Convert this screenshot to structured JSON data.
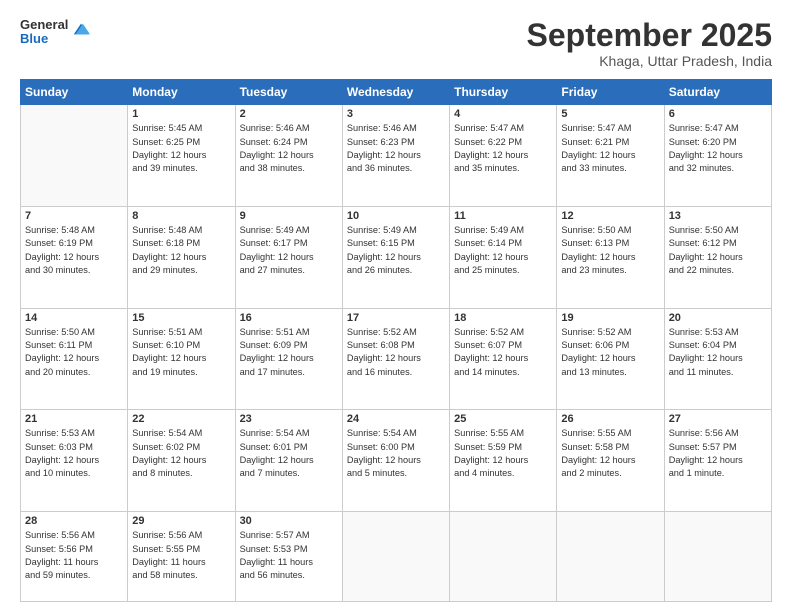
{
  "header": {
    "logo": {
      "general": "General",
      "blue": "Blue"
    },
    "title": "September 2025",
    "subtitle": "Khaga, Uttar Pradesh, India"
  },
  "weekdays": [
    "Sunday",
    "Monday",
    "Tuesday",
    "Wednesday",
    "Thursday",
    "Friday",
    "Saturday"
  ],
  "weeks": [
    [
      {
        "day": "",
        "info": ""
      },
      {
        "day": "1",
        "info": "Sunrise: 5:45 AM\nSunset: 6:25 PM\nDaylight: 12 hours\nand 39 minutes."
      },
      {
        "day": "2",
        "info": "Sunrise: 5:46 AM\nSunset: 6:24 PM\nDaylight: 12 hours\nand 38 minutes."
      },
      {
        "day": "3",
        "info": "Sunrise: 5:46 AM\nSunset: 6:23 PM\nDaylight: 12 hours\nand 36 minutes."
      },
      {
        "day": "4",
        "info": "Sunrise: 5:47 AM\nSunset: 6:22 PM\nDaylight: 12 hours\nand 35 minutes."
      },
      {
        "day": "5",
        "info": "Sunrise: 5:47 AM\nSunset: 6:21 PM\nDaylight: 12 hours\nand 33 minutes."
      },
      {
        "day": "6",
        "info": "Sunrise: 5:47 AM\nSunset: 6:20 PM\nDaylight: 12 hours\nand 32 minutes."
      }
    ],
    [
      {
        "day": "7",
        "info": "Sunrise: 5:48 AM\nSunset: 6:19 PM\nDaylight: 12 hours\nand 30 minutes."
      },
      {
        "day": "8",
        "info": "Sunrise: 5:48 AM\nSunset: 6:18 PM\nDaylight: 12 hours\nand 29 minutes."
      },
      {
        "day": "9",
        "info": "Sunrise: 5:49 AM\nSunset: 6:17 PM\nDaylight: 12 hours\nand 27 minutes."
      },
      {
        "day": "10",
        "info": "Sunrise: 5:49 AM\nSunset: 6:15 PM\nDaylight: 12 hours\nand 26 minutes."
      },
      {
        "day": "11",
        "info": "Sunrise: 5:49 AM\nSunset: 6:14 PM\nDaylight: 12 hours\nand 25 minutes."
      },
      {
        "day": "12",
        "info": "Sunrise: 5:50 AM\nSunset: 6:13 PM\nDaylight: 12 hours\nand 23 minutes."
      },
      {
        "day": "13",
        "info": "Sunrise: 5:50 AM\nSunset: 6:12 PM\nDaylight: 12 hours\nand 22 minutes."
      }
    ],
    [
      {
        "day": "14",
        "info": "Sunrise: 5:50 AM\nSunset: 6:11 PM\nDaylight: 12 hours\nand 20 minutes."
      },
      {
        "day": "15",
        "info": "Sunrise: 5:51 AM\nSunset: 6:10 PM\nDaylight: 12 hours\nand 19 minutes."
      },
      {
        "day": "16",
        "info": "Sunrise: 5:51 AM\nSunset: 6:09 PM\nDaylight: 12 hours\nand 17 minutes."
      },
      {
        "day": "17",
        "info": "Sunrise: 5:52 AM\nSunset: 6:08 PM\nDaylight: 12 hours\nand 16 minutes."
      },
      {
        "day": "18",
        "info": "Sunrise: 5:52 AM\nSunset: 6:07 PM\nDaylight: 12 hours\nand 14 minutes."
      },
      {
        "day": "19",
        "info": "Sunrise: 5:52 AM\nSunset: 6:06 PM\nDaylight: 12 hours\nand 13 minutes."
      },
      {
        "day": "20",
        "info": "Sunrise: 5:53 AM\nSunset: 6:04 PM\nDaylight: 12 hours\nand 11 minutes."
      }
    ],
    [
      {
        "day": "21",
        "info": "Sunrise: 5:53 AM\nSunset: 6:03 PM\nDaylight: 12 hours\nand 10 minutes."
      },
      {
        "day": "22",
        "info": "Sunrise: 5:54 AM\nSunset: 6:02 PM\nDaylight: 12 hours\nand 8 minutes."
      },
      {
        "day": "23",
        "info": "Sunrise: 5:54 AM\nSunset: 6:01 PM\nDaylight: 12 hours\nand 7 minutes."
      },
      {
        "day": "24",
        "info": "Sunrise: 5:54 AM\nSunset: 6:00 PM\nDaylight: 12 hours\nand 5 minutes."
      },
      {
        "day": "25",
        "info": "Sunrise: 5:55 AM\nSunset: 5:59 PM\nDaylight: 12 hours\nand 4 minutes."
      },
      {
        "day": "26",
        "info": "Sunrise: 5:55 AM\nSunset: 5:58 PM\nDaylight: 12 hours\nand 2 minutes."
      },
      {
        "day": "27",
        "info": "Sunrise: 5:56 AM\nSunset: 5:57 PM\nDaylight: 12 hours\nand 1 minute."
      }
    ],
    [
      {
        "day": "28",
        "info": "Sunrise: 5:56 AM\nSunset: 5:56 PM\nDaylight: 11 hours\nand 59 minutes."
      },
      {
        "day": "29",
        "info": "Sunrise: 5:56 AM\nSunset: 5:55 PM\nDaylight: 11 hours\nand 58 minutes."
      },
      {
        "day": "30",
        "info": "Sunrise: 5:57 AM\nSunset: 5:53 PM\nDaylight: 11 hours\nand 56 minutes."
      },
      {
        "day": "",
        "info": ""
      },
      {
        "day": "",
        "info": ""
      },
      {
        "day": "",
        "info": ""
      },
      {
        "day": "",
        "info": ""
      }
    ]
  ]
}
